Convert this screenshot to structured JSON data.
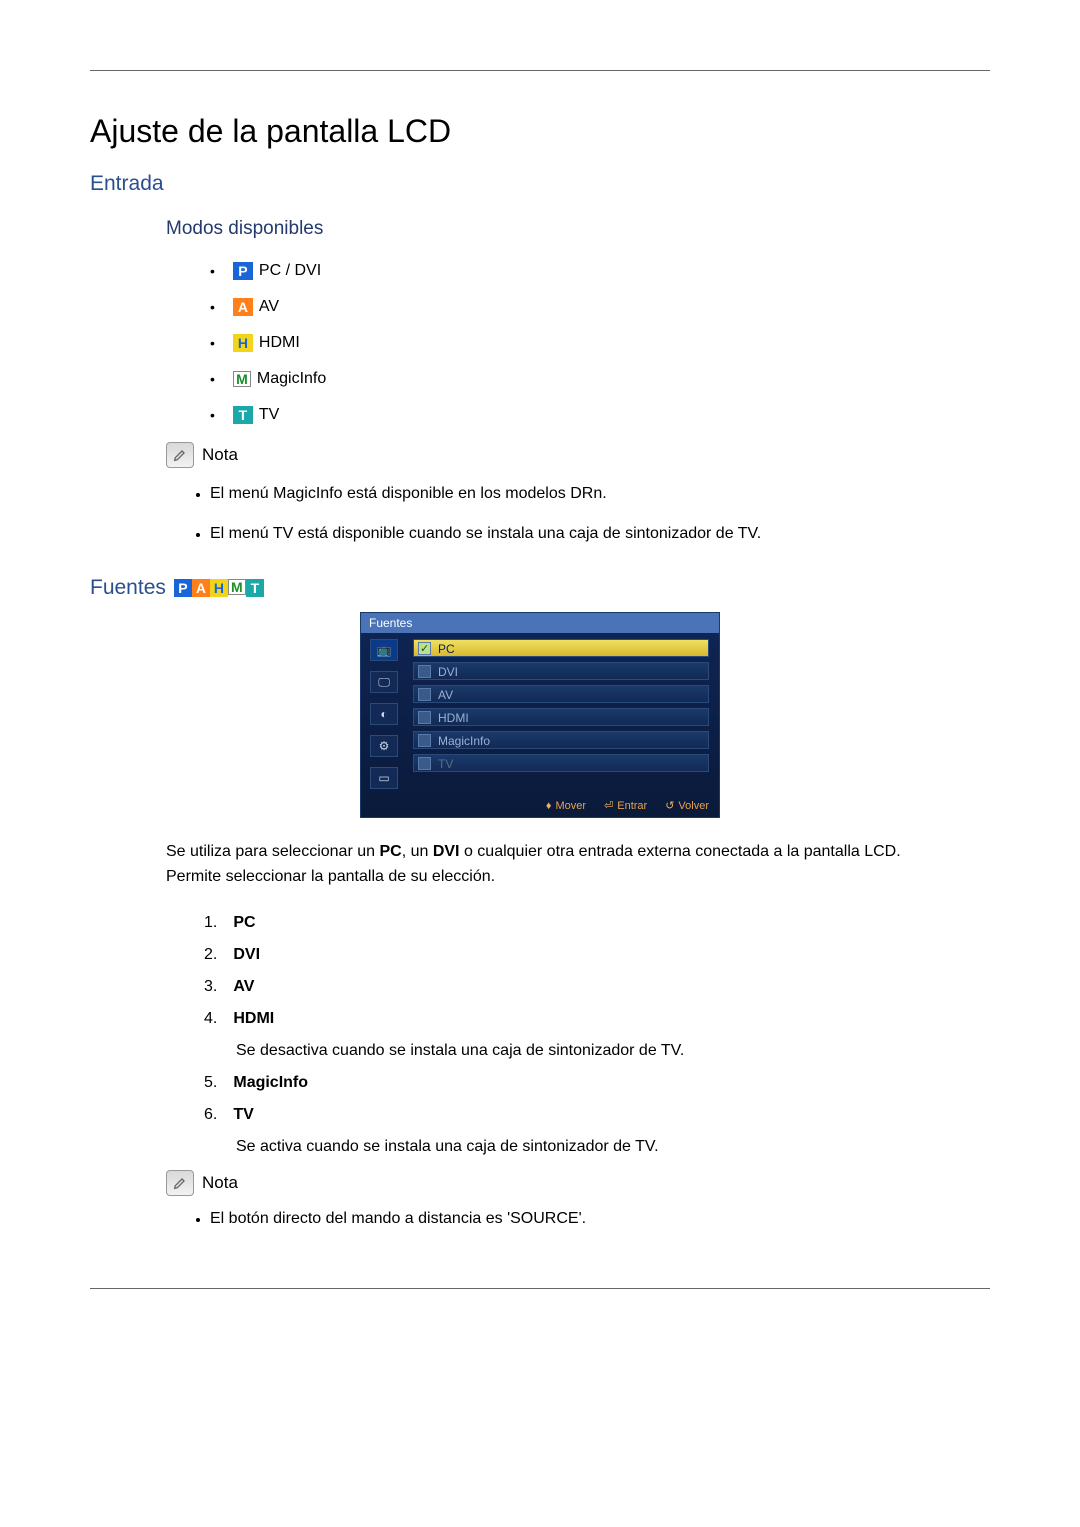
{
  "title": "Ajuste de la pantalla LCD",
  "entrada": {
    "heading": "Entrada",
    "modos_heading": "Modos disponibles",
    "modes": [
      {
        "badge": "P",
        "label": "PC / DVI",
        "cls": "badge-P"
      },
      {
        "badge": "A",
        "label": "AV",
        "cls": "badge-A"
      },
      {
        "badge": "H",
        "label": "HDMI",
        "cls": "badge-H"
      },
      {
        "badge": "M",
        "label": "MagicInfo",
        "cls": "badge-M"
      },
      {
        "badge": "T",
        "label": "TV",
        "cls": "badge-T"
      }
    ],
    "nota_label": "Nota",
    "notas": [
      "El menú MagicInfo está disponible en los modelos DRn.",
      "El menú TV está disponible cuando se instala una caja de sintonizador de TV."
    ]
  },
  "fuentes": {
    "heading": "Fuentes",
    "badges": [
      "P",
      "A",
      "H",
      "M",
      "T"
    ],
    "osd": {
      "title": "Fuentes",
      "items": [
        {
          "label": "PC",
          "state": "sel"
        },
        {
          "label": "DVI",
          "state": ""
        },
        {
          "label": "AV",
          "state": ""
        },
        {
          "label": "HDMI",
          "state": ""
        },
        {
          "label": "MagicInfo",
          "state": ""
        },
        {
          "label": "TV",
          "state": "dis"
        }
      ],
      "footer": {
        "mover": "Mover",
        "entrar": "Entrar",
        "volver": "Volver"
      }
    },
    "description": "Se utiliza para seleccionar un PC, un DVI o cualquier otra entrada externa conectada a la pantalla LCD. Permite seleccionar la pantalla de su elección.",
    "list": [
      {
        "label": "PC"
      },
      {
        "label": "DVI"
      },
      {
        "label": "AV"
      },
      {
        "label": "HDMI",
        "sub": "Se desactiva cuando se instala una caja de sintonizador de TV."
      },
      {
        "label": "MagicInfo"
      },
      {
        "label": "TV",
        "sub": "Se activa cuando se instala una caja de sintonizador de TV."
      }
    ],
    "nota_label": "Nota",
    "nota_items": [
      "El botón directo del mando a distancia es 'SOURCE'."
    ]
  }
}
